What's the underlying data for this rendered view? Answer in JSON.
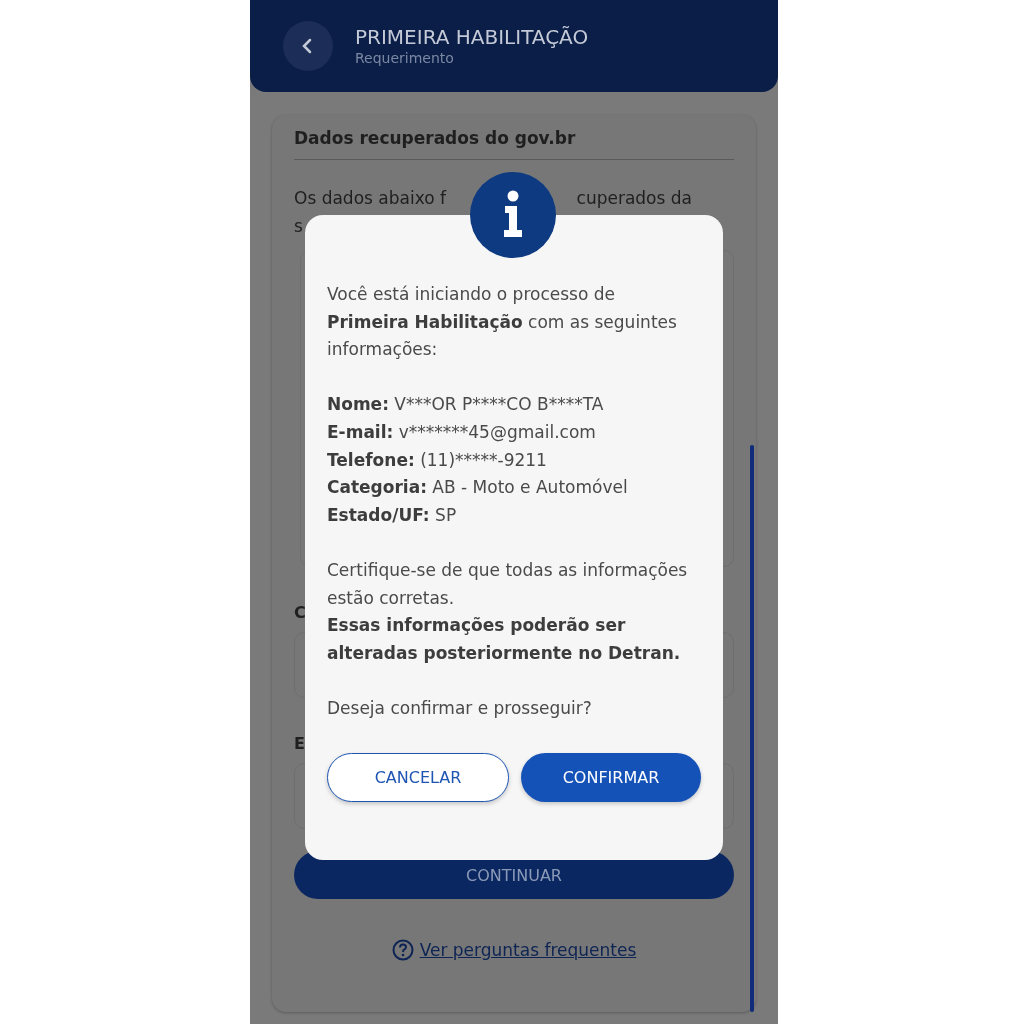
{
  "header": {
    "title": "PRIMEIRA HABILITAÇÃO",
    "subtitle": "Requerimento"
  },
  "card": {
    "title": "Dados recuperados do gov.br",
    "intro_left": "Os dados abaixo f",
    "intro_right": "cuperados da",
    "intro_line_2": "s",
    "label_1": "C",
    "label_2": "E",
    "continue_button": "CONTINUAR",
    "faq_link": "Ver perguntas frequentes"
  },
  "dialog": {
    "intro": "Você está iniciando o processo de **Primeira Habilitação** com as seguintes informações:",
    "fields": [
      {
        "label": "Nome:",
        "value": "V***OR P****CO B****TA"
      },
      {
        "label": "E-mail:",
        "value": "v*******45@gmail.com"
      },
      {
        "label": "Telefone:",
        "value": "(11)*****-9211"
      },
      {
        "label": "Categoria:",
        "value": "AB - Moto e Automóvel"
      },
      {
        "label": "Estado/UF:",
        "value": "SP"
      }
    ],
    "note": "Certifique-se de que todas as informações estão corretas.",
    "warning": "Essas informações poderão ser alteradas posteriormente no Detran.",
    "question": "Deseja confirmar e prosseguir?",
    "buttons": [
      {
        "label": "CANCELAR",
        "kind": "outline"
      },
      {
        "label": "CONFIRMAR",
        "kind": "filled"
      }
    ]
  }
}
